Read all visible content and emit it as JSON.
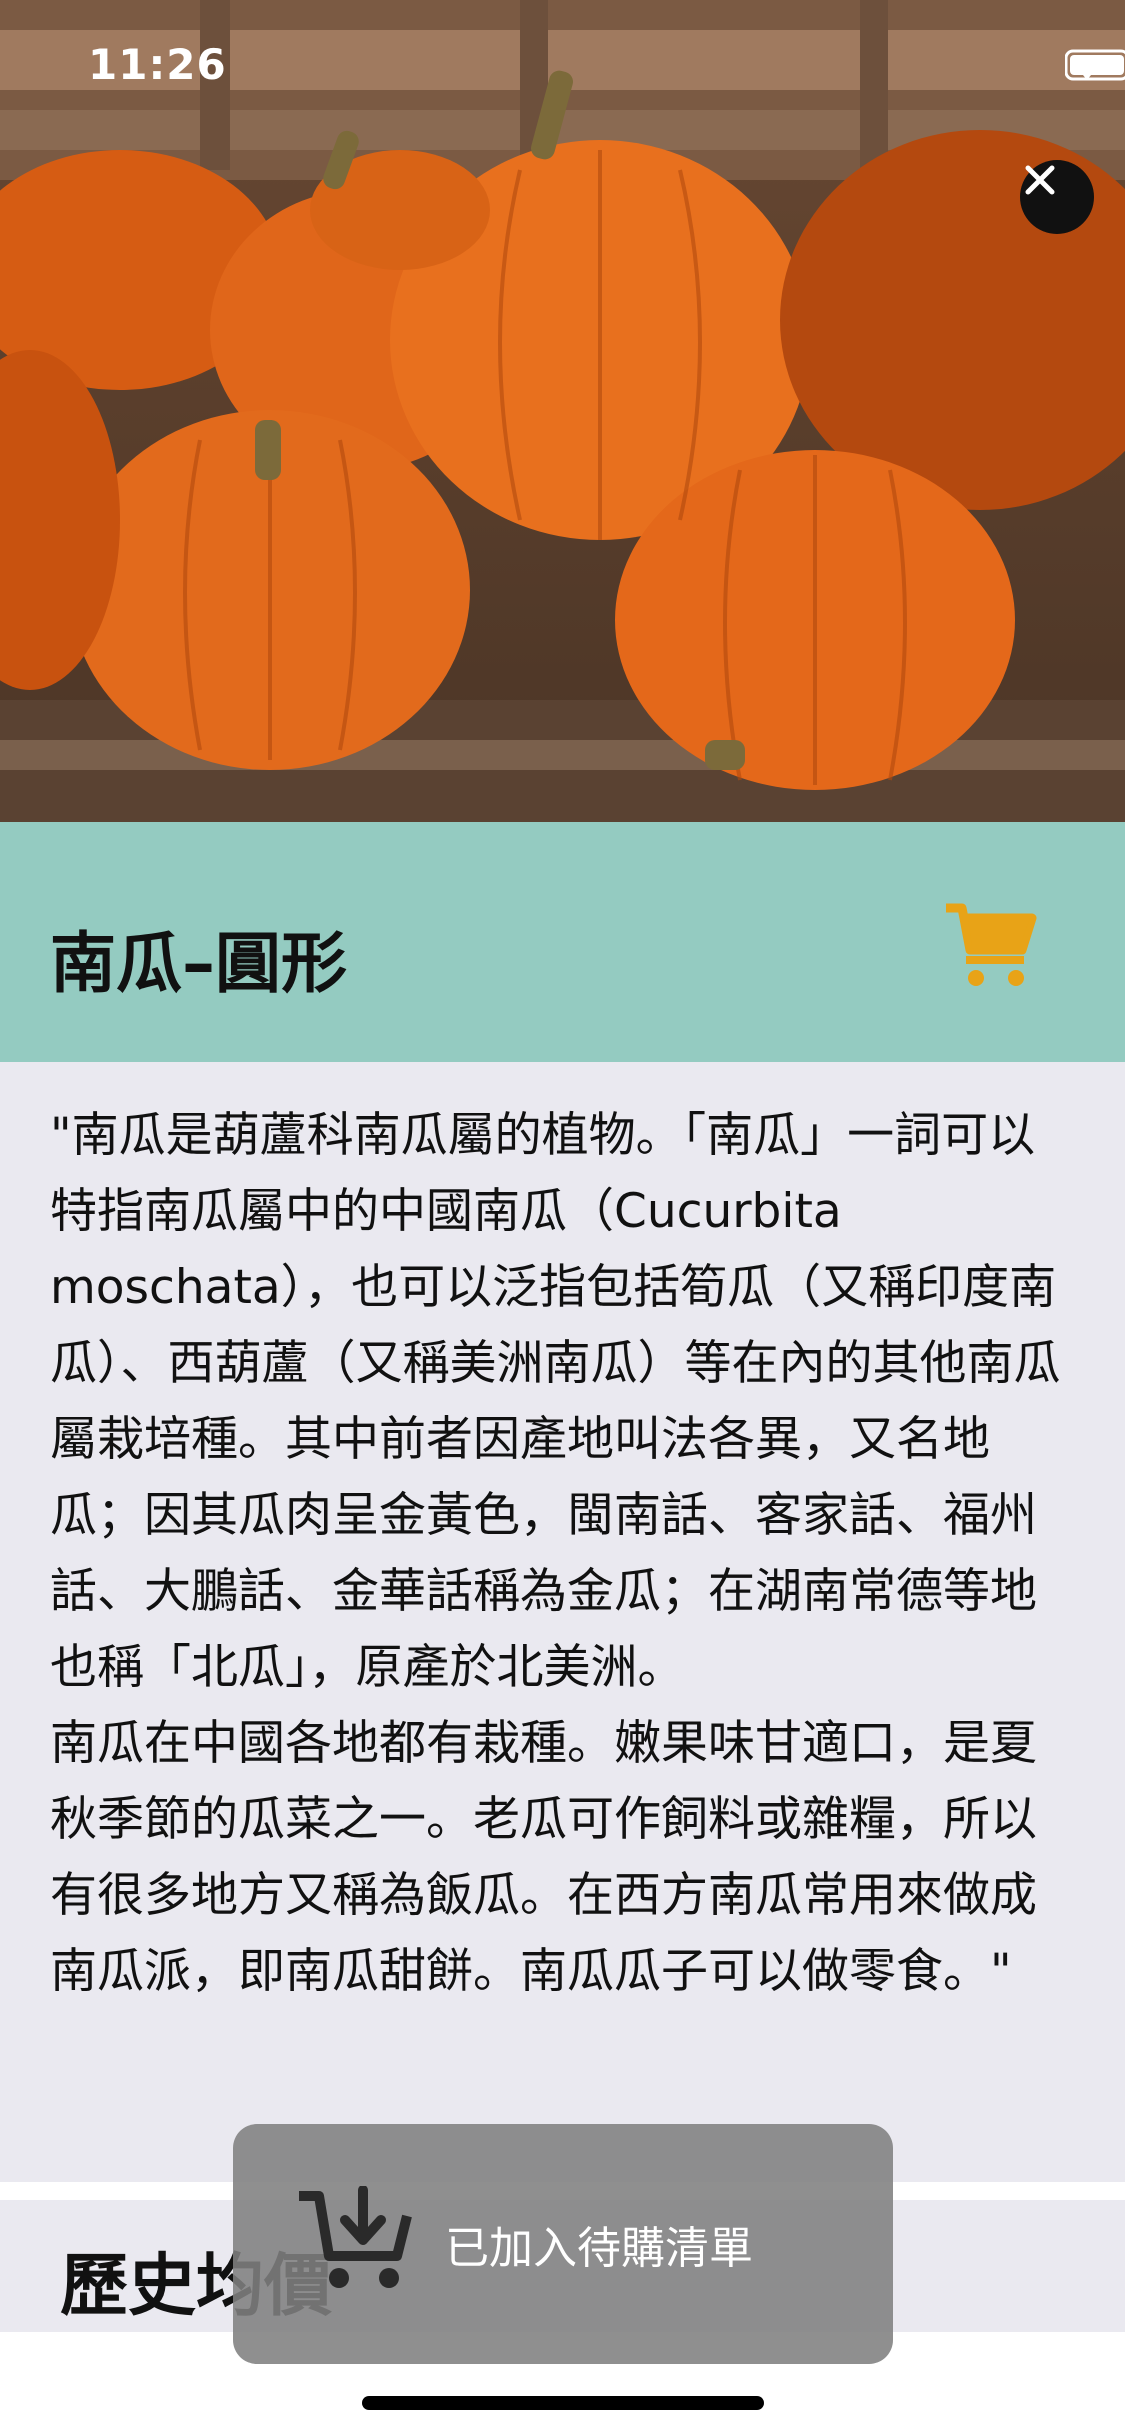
{
  "status_bar": {
    "time": "11:26",
    "wifi_icon": "wifi-icon",
    "battery_icon": "battery-icon"
  },
  "hero": {
    "image_icon": "pumpkin-photo",
    "close_icon": "close-icon"
  },
  "product": {
    "title": "南瓜–圓形",
    "cart_icon": "cart-icon",
    "accent_color": "#e8a317",
    "header_color": "#94cbc1"
  },
  "description": {
    "text": "\"南瓜是葫蘆科南瓜屬的植物。「南瓜」一詞可以特指南瓜屬中的中國南瓜（Cucurbita moschata），也可以泛指包括筍瓜（又稱印度南瓜）、西葫蘆（又稱美洲南瓜）等在內的其他南瓜屬栽培種。其中前者因產地叫法各異，又名地瓜；因其瓜肉呈金黃色，閩南話、客家話、福州話、大鵬話、金華話稱為金瓜；在湖南常德等地也稱「北瓜」，原產於北美洲。\n南瓜在中國各地都有栽種。嫩果味甘適口，是夏秋季節的瓜菜之一。老瓜可作飼料或雜糧，所以有很多地方又稱為飯瓜。在西方南瓜常用來做成南瓜派，即南瓜甜餅。南瓜瓜子可以做零食。\""
  },
  "section": {
    "title": "歷史均價"
  },
  "toast": {
    "message": "已加入待購清單",
    "icon": "cart-download-icon"
  }
}
